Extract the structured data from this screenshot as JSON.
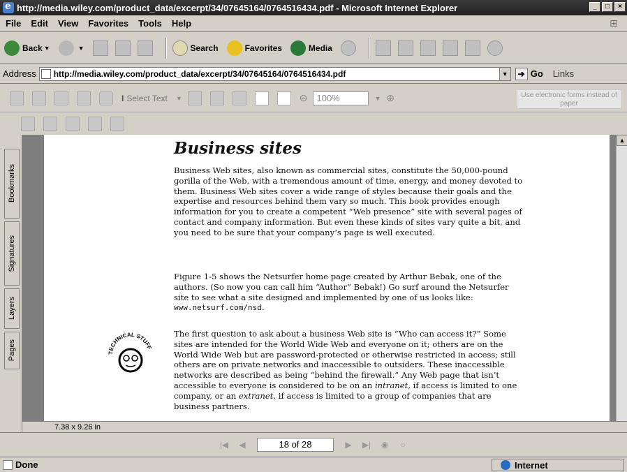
{
  "window": {
    "title": "http://media.wiley.com/product_data/excerpt/34/07645164/0764516434.pdf - Microsoft Internet Explorer",
    "minimize": "_",
    "maximize": "□",
    "close": "×"
  },
  "menu": [
    "File",
    "Edit",
    "View",
    "Favorites",
    "Tools",
    "Help"
  ],
  "toolbar": {
    "back": "Back",
    "search": "Search",
    "favorites": "Favorites",
    "media": "Media"
  },
  "address": {
    "label": "Address",
    "url": "http://media.wiley.com/product_data/excerpt/34/07645164/0764516434.pdf",
    "go": "Go",
    "links": "Links"
  },
  "pdf_toolbar": {
    "select_text": "Select Text",
    "zoom": "100%",
    "forms_button": "Use electronic forms instead of paper"
  },
  "nav_tabs": [
    "Bookmarks",
    "Signatures",
    "Layers",
    "Pages"
  ],
  "page": {
    "heading": "Business sites",
    "para1": "Business Web sites, also known as commercial sites, constitute the 50,000-pound gorilla of the Web, with a tremendous amount of time, energy, and money devoted to them. Business Web sites cover a wide range of styles because their goals and the expertise and resources behind them vary so much. This book provides enough information for you to create a competent “Web presence” site with several pages of contact and company information. But even these kinds of sites vary quite a bit, and you need to be sure that your company’s page is well executed.",
    "para2_text": "Figure 1-5 shows the Netsurfer home page created by Arthur Bebak, one of the authors. (So now you can call him “Author” Bebak!) Go surf around the Netsurfer site to see what a site designed and implemented by one of us looks like: ",
    "para2_url": "www.netsurf.com/nsd",
    "para2_end": ".",
    "para3_a": "The first question to ask about a business Web site is “Who can access it?” Some sites are intended for the World Wide Web and everyone on it; others are on the World Wide Web but are password-protected or otherwise restricted in access; still others are on private networks and inaccessible to outsiders. These inaccessible networks are described as being “behind the firewall.” Any Web page that isn’t accessible to everyone is considered to be on an ",
    "para3_intranet": "intranet,",
    "para3_b": " if access is limited to one company, or an ",
    "para3_extranet": "extranet,",
    "para3_c": " if access is limited to a group of companies that are business partners.",
    "badge_text": "TECHNICAL STUFF",
    "size": "7.38 x 9.26 in"
  },
  "pagebar": {
    "page_indicator": "18 of 28"
  },
  "status": {
    "text": "Done",
    "zone": "Internet"
  }
}
